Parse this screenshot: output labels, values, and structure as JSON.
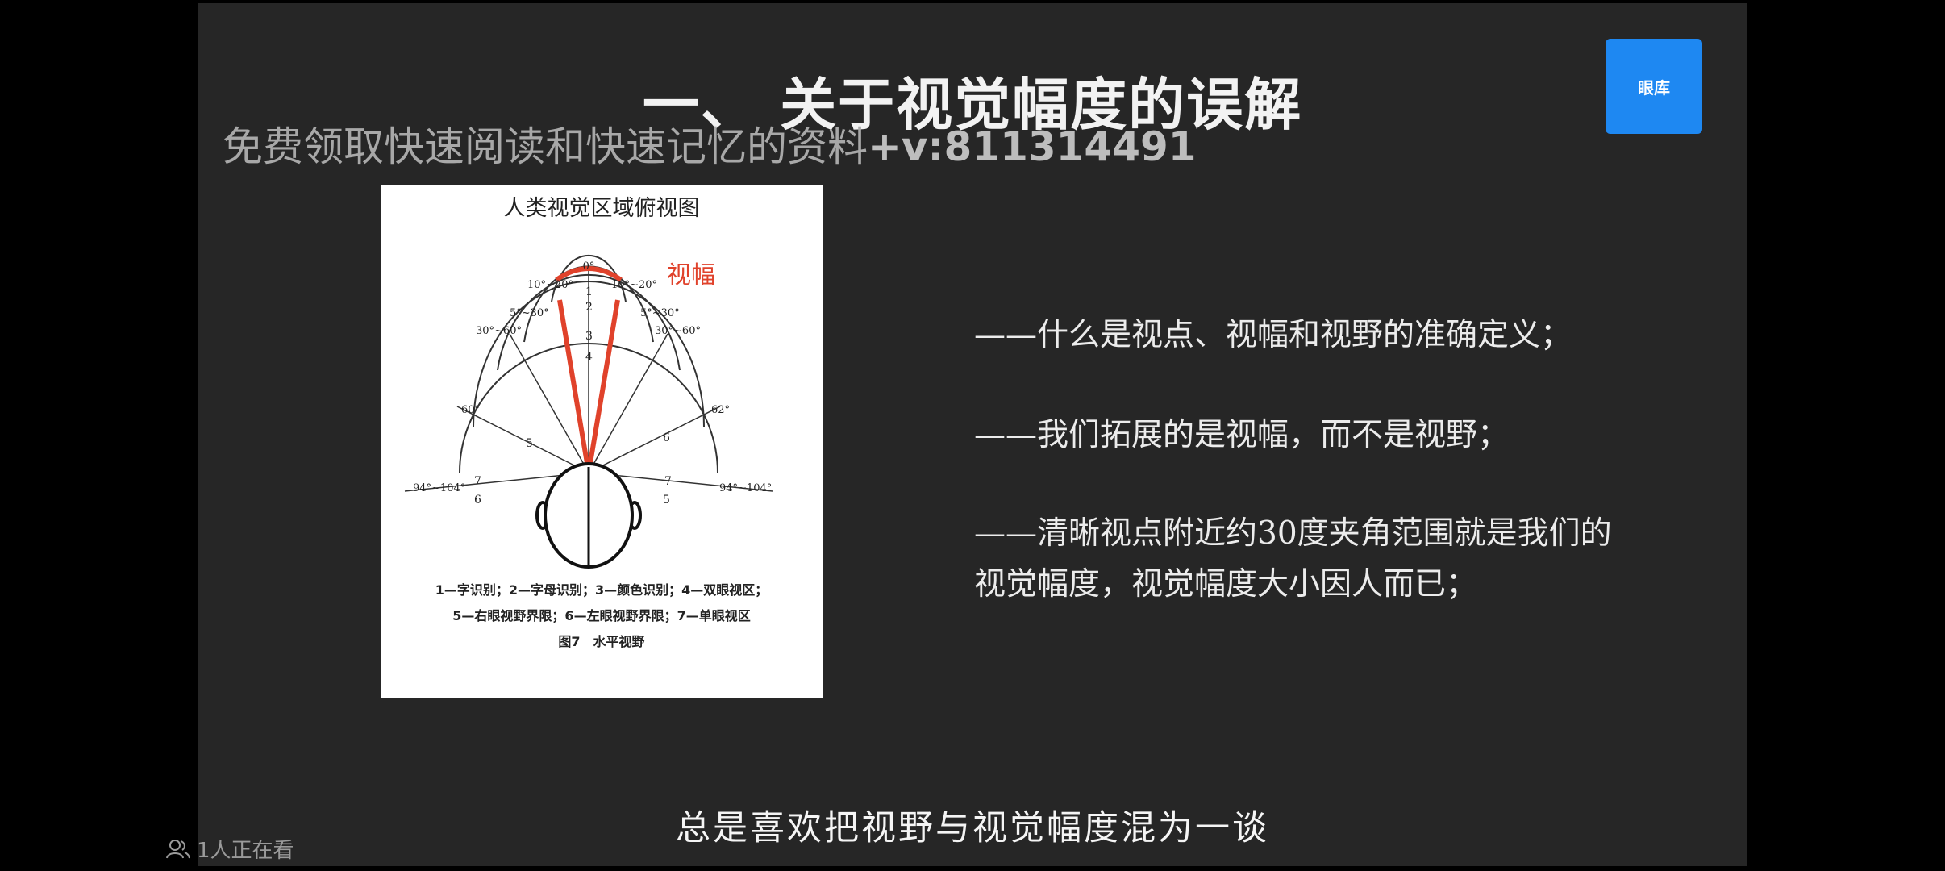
{
  "slide": {
    "title": "一、 关于视觉幅度的误解",
    "watermark_text": "免费领取快速阅读和快速记忆的资料",
    "watermark_contact": "+v:811314491",
    "corner_button_label": "眼库",
    "figure": {
      "title": "人类视觉区域俯视图",
      "highlight_label": "视幅",
      "angle_labels": [
        "0°",
        "10°~20°",
        "10°~20°",
        "5°~30°",
        "5°~30°",
        "30°~60°",
        "30°~60°",
        "60°",
        "62°",
        "94°~104°",
        "94°~104°"
      ],
      "zone_numbers": [
        "1",
        "2",
        "3",
        "4",
        "5",
        "6",
        "7",
        "6",
        "7",
        "5"
      ],
      "legend_line1": "1—字识别；2—字母识别；3—颜色识别；4—双眼视区；",
      "legend_line2": "5—右眼视野界限；6—左眼视野界限；7—单眼视区",
      "caption": "图7　水平视野"
    },
    "bullets": [
      "——什么是视点、视幅和视野的准确定义；",
      "——我们拓展的是视幅，而不是视野；",
      "——清晰视点附近约30度夹角范围就是我们的视觉幅度，视觉幅度大小因人而已；"
    ],
    "subtitle": "总是喜欢把视野与视觉幅度混为一谈"
  },
  "status": {
    "viewers_text": "1人正在看",
    "viewers_icon": "people-icon"
  },
  "colors": {
    "background": "#000000",
    "slide_bg": "#262626",
    "button_blue": "#1e88f2",
    "highlight_red": "#e0422b"
  }
}
